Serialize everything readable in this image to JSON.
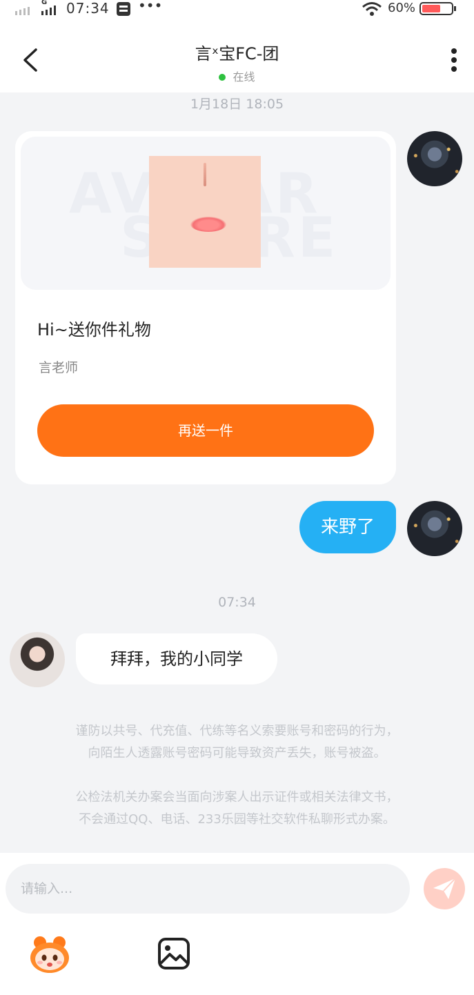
{
  "status_bar": {
    "time": "07:34",
    "battery": "60%",
    "network": "G"
  },
  "header": {
    "title": "言ˣ宝FC-团",
    "status": "在线"
  },
  "timestamps": {
    "first": "1月18日 18:05",
    "second": "07:34"
  },
  "gift_card": {
    "watermark_top": "AVATAR",
    "watermark_bottom": "STORE",
    "title": "Hi~送你件礼物",
    "sender": "言老师",
    "button_label": "再送一件"
  },
  "messages": {
    "sent": "来野了",
    "received": "拜拜，我的小同学"
  },
  "notices": [
    "谨防以共号、代充值、代练等名义索要账号和密码的行为，",
    "向陌生人透露账号密码可能导致资产丢失，账号被盗。",
    "公检法机关办案会当面向涉案人出示证件或相关法律文书，",
    "不会通过QQ、电话、233乐园等社交软件私聊形式办案。"
  ],
  "input": {
    "placeholder": "请输入..."
  },
  "colors": {
    "accent": "#ff7215",
    "bubble_sent": "#25b0f4",
    "online": "#2ec13f"
  },
  "icons": [
    "back-arrow-icon",
    "more-vertical-icon",
    "send-icon",
    "emoji-icon",
    "image-icon",
    "wifi-icon",
    "signal-icon",
    "battery-icon"
  ]
}
